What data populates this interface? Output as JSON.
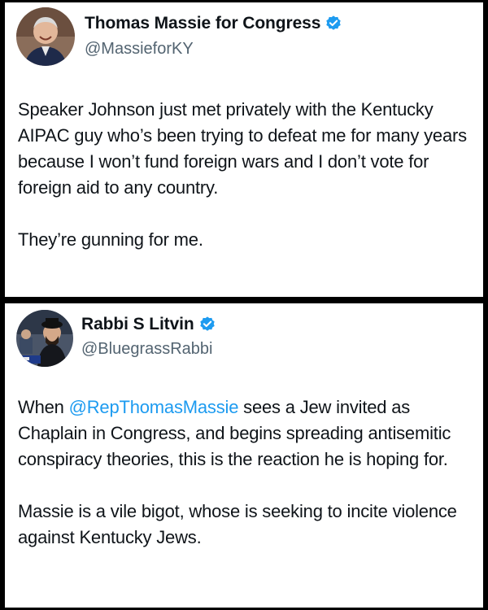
{
  "tweets": [
    {
      "display_name": "Thomas Massie for Congress",
      "handle": "@MassieforKY",
      "verified": true,
      "avatar_icon": "avatar-photo-man-smiling",
      "paragraphs": [
        "Speaker Johnson just met privately with the Kentucky AIPAC guy who’s been trying to defeat me for many years because I won’t fund foreign wars and I don’t vote for foreign aid to any country.",
        "They’re gunning for me."
      ]
    },
    {
      "display_name": "Rabbi S Litvin",
      "handle": "@BluegrassRabbi",
      "verified": true,
      "avatar_icon": "avatar-photo-man-at-event",
      "mention": "@RepThomasMassie",
      "paragraphs": [
        "When",
        " sees a Jew invited as Chaplain in Congress, and begins spreading antisemitic conspiracy theories, this is the reaction he is hoping for.",
        "Massie is a vile bigot, whose is seeking to incite violence against Kentucky Jews."
      ]
    }
  ],
  "colors": {
    "text": "#0f1419",
    "secondary": "#536471",
    "link": "#1d9bf0",
    "verified_badge": "#1d9bf0",
    "separator": "#000000"
  }
}
